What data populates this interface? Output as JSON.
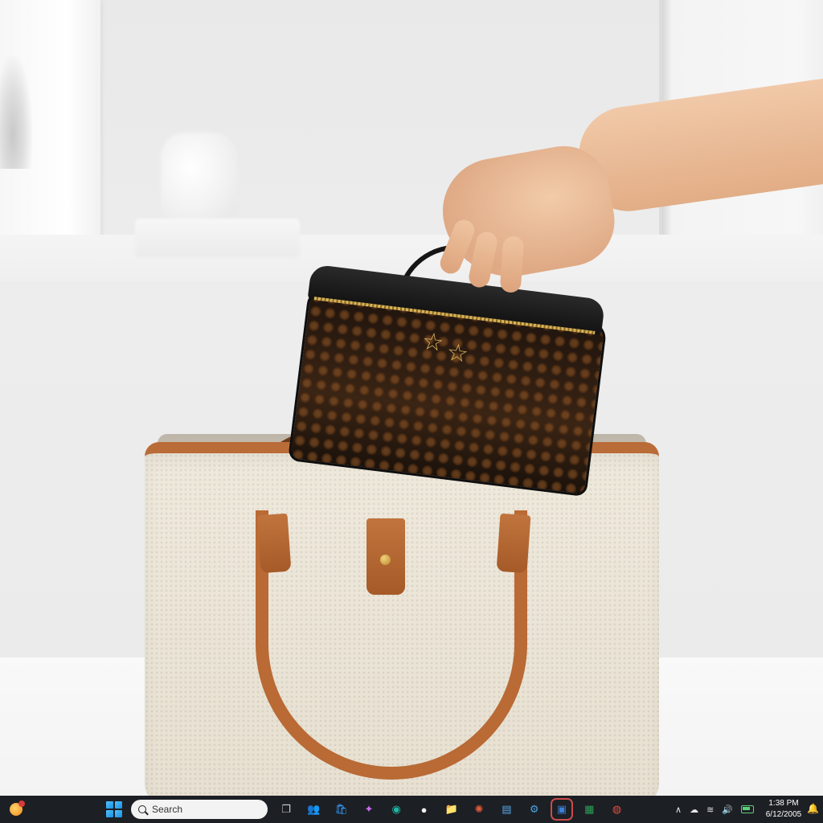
{
  "taskbar": {
    "search_label": "Search",
    "clock": {
      "time": "1:38 PM",
      "date": "6/12/2005"
    },
    "pinned_apps": [
      {
        "name": "task-view-icon",
        "glyph": "❐",
        "color": "#cfcfcf"
      },
      {
        "name": "teams-icon",
        "glyph": "👥",
        "color": "#7b83eb"
      },
      {
        "name": "store-icon",
        "glyph": "🛍",
        "color": "#3aa0ff"
      },
      {
        "name": "copilot-icon",
        "glyph": "✦",
        "color": "#c96cf0"
      },
      {
        "name": "edge-icon",
        "glyph": "◉",
        "color": "#1fb6a6"
      },
      {
        "name": "chat-icon",
        "glyph": "●",
        "color": "#f0f0f0"
      },
      {
        "name": "file-explorer-icon",
        "glyph": "📁",
        "color": "#f5c242"
      },
      {
        "name": "sparkle-app-icon",
        "glyph": "✺",
        "color": "#e05a3a"
      },
      {
        "name": "notepad-icon",
        "glyph": "▤",
        "color": "#5aa7e8"
      },
      {
        "name": "control-panel-icon",
        "glyph": "⚙",
        "color": "#4da3e0"
      },
      {
        "name": "remote-desktop-icon",
        "glyph": "▣",
        "color": "#3b7fd8"
      },
      {
        "name": "excel-icon",
        "glyph": "▦",
        "color": "#2e9e57"
      },
      {
        "name": "chrome-icon",
        "glyph": "◍",
        "color": "#e94b3c"
      }
    ],
    "active_app": "remote-desktop-icon"
  }
}
